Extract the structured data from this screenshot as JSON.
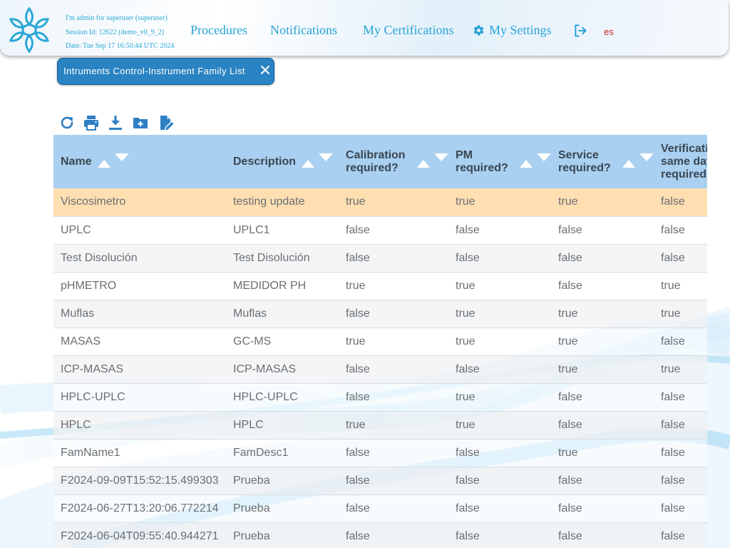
{
  "header": {
    "session": {
      "user_line": "I'm admin for superuser (superuser)",
      "session_line": "Session Id: 12622 (demo_v0_9_2)",
      "date_line": "Date: Tue Sep 17 16:50:44 UTC 2024"
    },
    "nav": {
      "procedures": "Procedures",
      "notifications": "Notifications",
      "certifications": "My Certifications",
      "settings": "My Settings"
    },
    "logout_icon": "logout-icon",
    "language": "es",
    "accent_color": "#27a3d6"
  },
  "tab": {
    "label": "Intruments Control-Instrument Family List",
    "close_icon": "close-icon"
  },
  "toolbar": {
    "icons": [
      "refresh-icon",
      "print-icon",
      "download-icon",
      "new-folder-icon",
      "edit-document-icon"
    ]
  },
  "table": {
    "columns": [
      "Name",
      "Description",
      "Calibration required?",
      "PM required?",
      "Service required?",
      "Verification same day required?"
    ],
    "rows": [
      [
        "Viscosimetro",
        "testing update",
        "true",
        "true",
        "true",
        "false"
      ],
      [
        "UPLC",
        "UPLC1",
        "false",
        "false",
        "false",
        "false"
      ],
      [
        "Test Disolución",
        "Test Disolución",
        "false",
        "false",
        "false",
        "false"
      ],
      [
        "pHMETRO",
        "MEDIDOR PH",
        "true",
        "true",
        "false",
        "true"
      ],
      [
        "Muflas",
        "Muflas",
        "false",
        "true",
        "true",
        "true"
      ],
      [
        "MASAS",
        "GC-MS",
        "true",
        "true",
        "true",
        "false"
      ],
      [
        "ICP-MASAS",
        "ICP-MASAS",
        "false",
        "false",
        "true",
        "true"
      ],
      [
        "HPLC-UPLC",
        "HPLC-UPLC",
        "false",
        "true",
        "false",
        "false"
      ],
      [
        "HPLC",
        "HPLC",
        "true",
        "true",
        "false",
        "false"
      ],
      [
        "FamName1",
        "FamDesc1",
        "false",
        "false",
        "true",
        "false"
      ],
      [
        "F2024-09-09T15:52:15.499303",
        "Prueba",
        "false",
        "false",
        "false",
        "false"
      ],
      [
        "F2024-06-27T13:20:06.772214",
        "Prueba",
        "false",
        "false",
        "false",
        "false"
      ],
      [
        "F2024-06-04T09:55:40.944271",
        "Prueba",
        "false",
        "false",
        "false",
        "false"
      ]
    ],
    "selected_row": 0,
    "header_color": "#a9d0f0",
    "selected_color": "#ffdfb2"
  }
}
